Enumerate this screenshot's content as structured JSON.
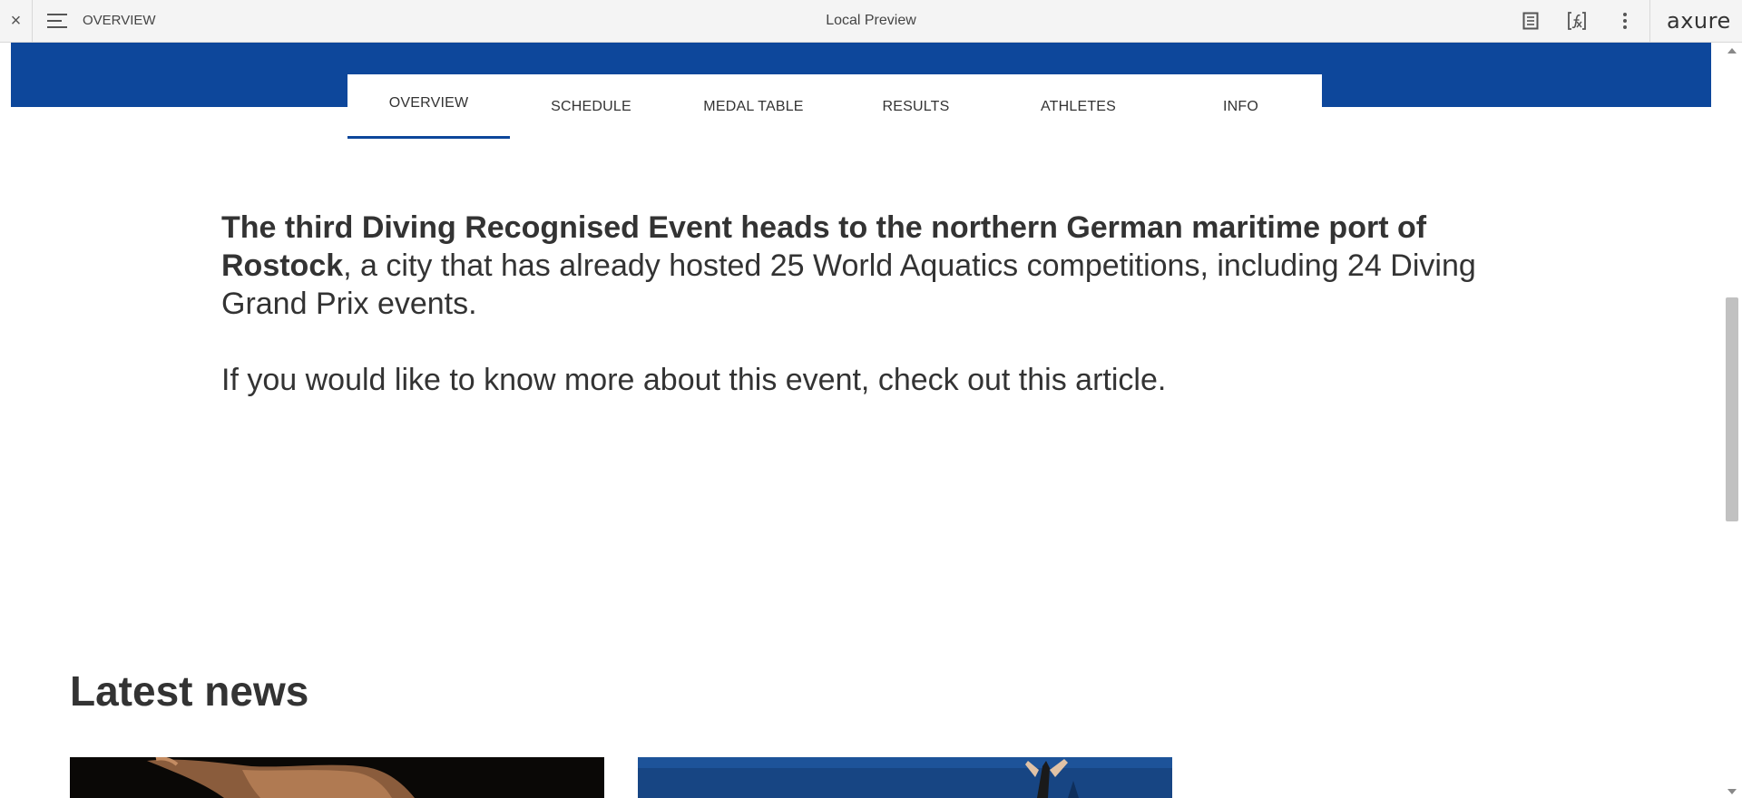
{
  "toolbar": {
    "close_glyph": "×",
    "menu_icon": "hamburger-menu-icon",
    "page_name": "OVERVIEW",
    "title": "Local Preview",
    "icons": [
      "notes-icon",
      "variables-icon",
      "more-vertical-icon"
    ],
    "logo": "axure"
  },
  "colors": {
    "brand_blue": "#0d479b",
    "text": "#333333",
    "toolbar_bg": "#f4f4f4"
  },
  "tabs": [
    {
      "label": "OVERVIEW",
      "active": true
    },
    {
      "label": "SCHEDULE",
      "active": false
    },
    {
      "label": "MEDAL TABLE",
      "active": false
    },
    {
      "label": "RESULTS",
      "active": false
    },
    {
      "label": "ATHLETES",
      "active": false
    },
    {
      "label": "INFO",
      "active": false
    }
  ],
  "intro": {
    "bold_lead": "The third Diving Recognised Event heads to the northern German maritime port of Rostock",
    "lead_rest": ", a city that has already hosted 25 World Aquatics competitions, including 24 Diving Grand Prix events.",
    "second_paragraph": "If you would like to know more about this event, check out this article."
  },
  "latest_news": {
    "title": "Latest news"
  }
}
